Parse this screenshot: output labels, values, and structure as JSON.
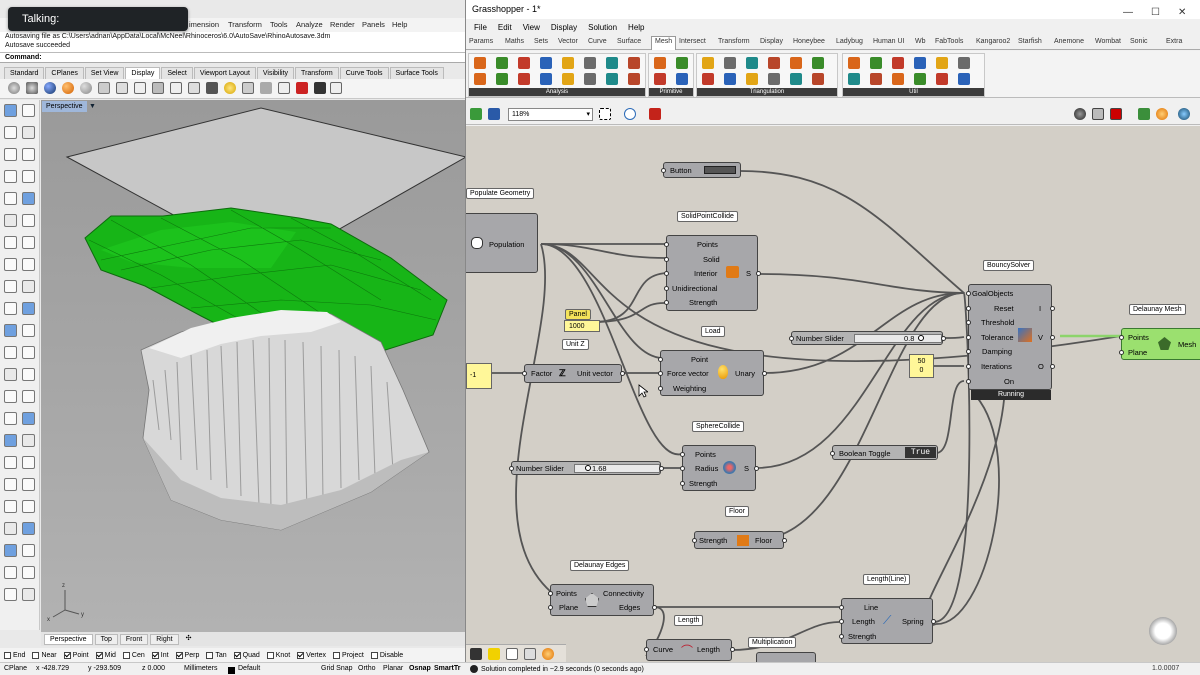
{
  "overlay": {
    "talking": "Talking:"
  },
  "rhino": {
    "menu": [
      "imension",
      "Transform",
      "Tools",
      "Analyze",
      "Render",
      "Panels",
      "Help"
    ],
    "history": [
      "Autosaving file as C:\\Users\\adnan\\AppData\\Local\\McNeel\\Rhinoceros\\6.0\\AutoSave\\RhinoAutosave.3dm",
      "Autosave succeeded"
    ],
    "command_label": "Command:",
    "toolbar_tabs": [
      "Standard",
      "CPlanes",
      "Set View",
      "Display",
      "Select",
      "Viewport Layout",
      "Visibility",
      "Transform",
      "Curve Tools",
      "Surface Tools"
    ],
    "active_toolbar_tab": "Display",
    "viewport": {
      "label": "Perspective",
      "arrow": "▼",
      "axis_x": "x",
      "axis_y": "y",
      "axis_z": "z"
    },
    "view_tabs": [
      "Perspective",
      "Top",
      "Front",
      "Right"
    ],
    "view_tab_add": "✣",
    "osnaps": [
      {
        "label": "End",
        "on": false
      },
      {
        "label": "Near",
        "on": false
      },
      {
        "label": "Point",
        "on": true
      },
      {
        "label": "Mid",
        "on": true
      },
      {
        "label": "Cen",
        "on": false
      },
      {
        "label": "Int",
        "on": true
      },
      {
        "label": "Perp",
        "on": true
      },
      {
        "label": "Tan",
        "on": false
      },
      {
        "label": "Quad",
        "on": true
      },
      {
        "label": "Knot",
        "on": false
      },
      {
        "label": "Vertex",
        "on": true
      },
      {
        "label": "Project",
        "on": false
      },
      {
        "label": "Disable",
        "on": false
      }
    ],
    "status": {
      "cplane": "CPlane",
      "x": "x -428.729",
      "y": "y -293.509",
      "z": "z 0.000",
      "units": "Millimeters",
      "layer": "Default",
      "grid": "Grid Snap",
      "ortho": "Ortho",
      "planar": "Planar",
      "osnap": "Osnap",
      "smart": "SmartTr"
    }
  },
  "gh": {
    "title": "Grasshopper - 1*",
    "window_buttons": [
      "—",
      "☐",
      "✕"
    ],
    "menu": [
      "File",
      "Edit",
      "View",
      "Display",
      "Solution",
      "Help"
    ],
    "tabs": [
      "Params",
      "Maths",
      "Sets",
      "Vector",
      "Curve",
      "Surface",
      "Mesh",
      "Intersect",
      "Transform",
      "Display",
      "Honeybee",
      "Ladybug",
      "Human UI",
      "Wb",
      "FabTools",
      "Kangaroo2",
      "Starfish",
      "Anemone",
      "Wombat",
      "Sonic",
      "Extra"
    ],
    "active_tab": "Mesh",
    "ribbon_groups": [
      "Analysis",
      "Primitive",
      "Triangulation",
      "Util"
    ],
    "zoom": "118%",
    "status_text": "Solution completed in ~2.9 seconds (0 seconds ago)",
    "version": "1.0.0007",
    "components": {
      "button": {
        "label": "Button"
      },
      "populate": {
        "title": "Populate Geometry",
        "output": "Population"
      },
      "solidpoint": {
        "title": "SolidPointCollide",
        "inputs": [
          "Points",
          "Solid",
          "Interior",
          "Unidirectional",
          "Strength"
        ],
        "output": "S"
      },
      "panel": {
        "title": "Panel",
        "value": "1000"
      },
      "load": {
        "title": "Load",
        "inputs": [
          "Point",
          "Force vector",
          "Weighting"
        ],
        "output": "Unary"
      },
      "unitz": {
        "title": "Unit Z",
        "input": "Factor",
        "output": "Unit vector"
      },
      "neg": {
        "value": "-1"
      },
      "bouncy": {
        "title": "BouncySolver",
        "inputs": [
          "GoalObjects",
          "Reset",
          "Threshold",
          "Tolerance",
          "Damping",
          "Iterations",
          "On"
        ],
        "outputs": [
          "I",
          "V",
          "O"
        ],
        "state": "Running"
      },
      "slider1": {
        "label": "Number Slider",
        "value": "0.8"
      },
      "panel50": {
        "values": [
          "50",
          "0"
        ]
      },
      "delaunay_mesh": {
        "title": "Delaunay Mesh",
        "inputs": [
          "Points",
          "Plane"
        ],
        "output": "Mesh"
      },
      "sphere": {
        "title": "SphereCollide",
        "inputs": [
          "Points",
          "Radius",
          "Strength"
        ],
        "output": "S"
      },
      "slider2": {
        "label": "Number Slider",
        "value": "1.68"
      },
      "toggle": {
        "label": "Boolean Toggle",
        "value": "True"
      },
      "floor": {
        "title": "Floor",
        "input": "Strength",
        "output": "Floor"
      },
      "delaunay_edges": {
        "title": "Delaunay Edges",
        "inputs": [
          "Points",
          "Plane"
        ],
        "outputs": [
          "Connectivity",
          "Edges"
        ]
      },
      "lengthline": {
        "title": "Length(Line)",
        "inputs": [
          "Line",
          "Length",
          "Strength"
        ],
        "output": "Spring"
      },
      "length": {
        "title": "Length",
        "input": "Curve",
        "output": "Length"
      },
      "mult": {
        "title": "Multiplication"
      }
    }
  }
}
